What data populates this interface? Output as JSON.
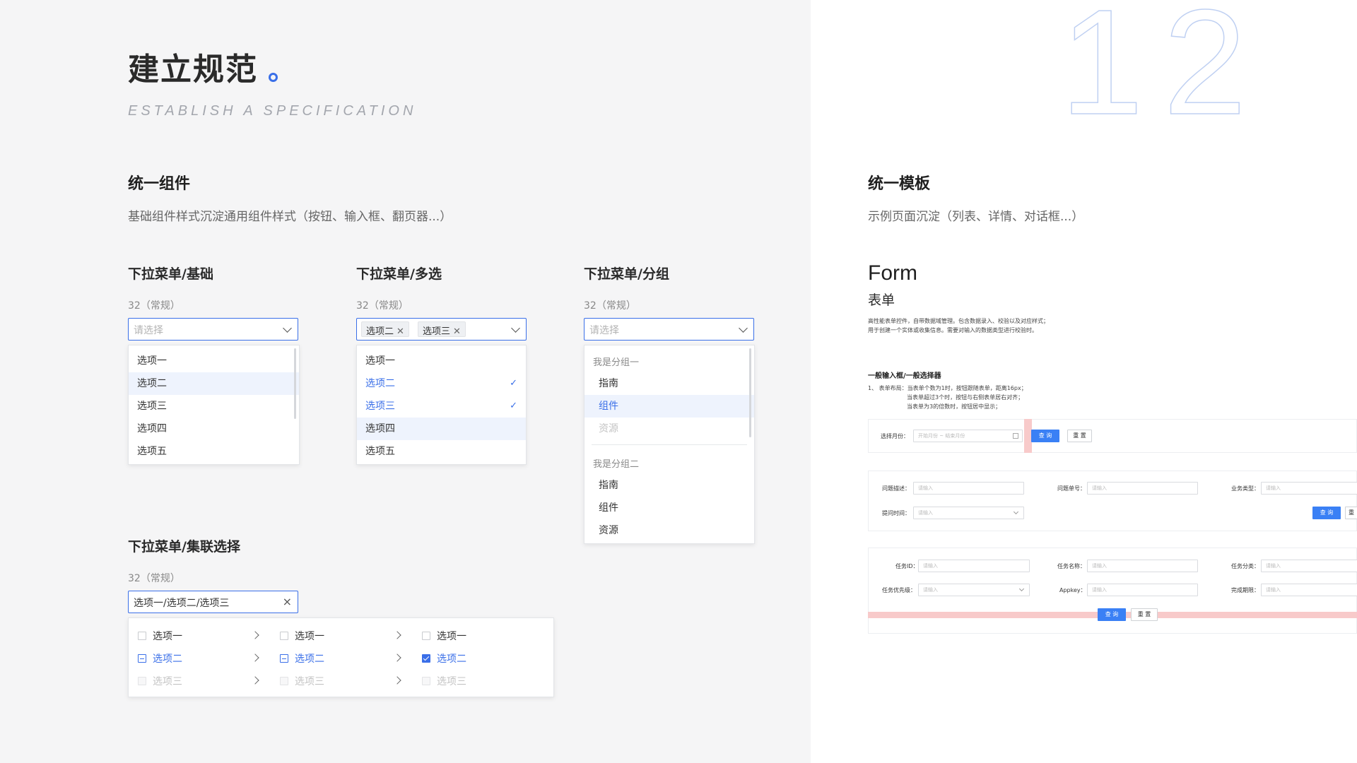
{
  "header": {
    "title": "建立规范",
    "subtitle": "ESTABLISH A SPECIFICATION",
    "page_number": "12"
  },
  "components": {
    "title": "统一组件",
    "desc": "基础组件样式沉淀通用组件样式（按钮、输入框、翻页器...）"
  },
  "templates": {
    "title": "统一模板",
    "desc": "示例页面沉淀（列表、详情、对话框...）"
  },
  "dropdown_basic": {
    "title": "下拉菜单/基础",
    "size": "32（常规）",
    "placeholder": "请选择",
    "options": [
      "选项一",
      "选项二",
      "选项三",
      "选项四",
      "选项五"
    ]
  },
  "dropdown_multi": {
    "title": "下拉菜单/多选",
    "size": "32（常规）",
    "tags": [
      "选项二",
      "选项三"
    ],
    "options": [
      "选项一",
      "选项二",
      "选项三",
      "选项四",
      "选项五"
    ]
  },
  "dropdown_group": {
    "title": "下拉菜单/分组",
    "size": "32（常规）",
    "placeholder": "请选择",
    "group1": {
      "label": "我是分组一",
      "items": [
        "指南",
        "组件",
        "资源"
      ]
    },
    "group2": {
      "label": "我是分组二",
      "items": [
        "指南",
        "组件",
        "资源"
      ]
    }
  },
  "dropdown_cascade": {
    "title": "下拉菜单/集联选择",
    "size": "32（常规）",
    "value": "选项一/选项二/选项三",
    "columns": [
      [
        "选项一",
        "选项二",
        "选项三"
      ],
      [
        "选项一",
        "选项二",
        "选项三"
      ],
      [
        "选项一",
        "选项二",
        "选项三"
      ]
    ]
  },
  "form": {
    "title": "Form",
    "subtitle": "表单",
    "desc1": "高性能表单控件，自带数据域管理。包含数据录入、校验以及对应样式；",
    "desc2": "用于创建一个实体或收集信息。需要对输入的数据类型进行校验时。",
    "section": "一般输入框/一般选择器",
    "rule1": "1、 表单布局：当表单个数为1时，按钮跟随表单，距离16px；",
    "rule2": "当表单超过3个时，按钮与右侧表单居右对齐；",
    "rule3": "当表单为3的倍数时，按钮居中显示；",
    "card1": {
      "label": "选择月份：",
      "placeholder": "开始月份  ~  结束月份",
      "query": "查 询",
      "reset": "重 置"
    },
    "card2": {
      "label1": "问题描述：",
      "ph1": "请输入",
      "label2": "问题单号：",
      "ph2": "请输入",
      "label3": "业务类型：",
      "ph3": "请输入",
      "label4": "提问时间：",
      "ph4": "请输入",
      "query": "查 询",
      "reset": "重"
    },
    "card3": {
      "label1": "任务ID：",
      "ph1": "请输入",
      "label2": "任务名称：",
      "ph2": "请输入",
      "label3": "任务分类：",
      "ph3": "请输入",
      "label4": "任务优先级：",
      "ph4": "请输入",
      "label5": "Appkey：",
      "ph5": "请输入",
      "label6": "完成期限：",
      "ph6": "请输入",
      "query": "查 询",
      "reset": "重 置"
    }
  },
  "colors": {
    "accent": "#3a6fe8",
    "button_primary": "#3a80f5",
    "highlight": "#eef3fd",
    "marker_pink": "#f8caca"
  }
}
